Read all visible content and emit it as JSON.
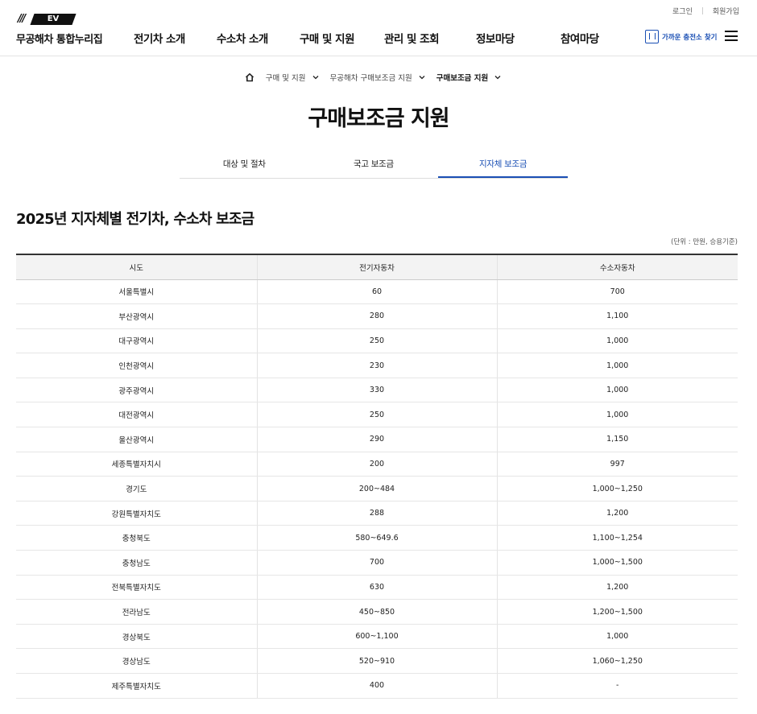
{
  "header": {
    "logo_badge": "EV",
    "logo_stripes": "///",
    "site_name": "무공해차 통합누리집",
    "util": {
      "login": "로그인",
      "signup": "회원가입"
    },
    "nav": [
      "전기차 소개",
      "수소차 소개",
      "구매 및 지원",
      "관리 및 조회",
      "정보마당",
      "참여마당"
    ],
    "charger_label": "가까운 충전소 찾기"
  },
  "breadcrumb": {
    "items": [
      "구매 및 지원",
      "무공해차 구매보조금 지원",
      "구매보조금 지원"
    ]
  },
  "page_title": "구매보조금 지원",
  "tabs": [
    {
      "label": "대상 및 절차",
      "active": false
    },
    {
      "label": "국고 보조금",
      "active": false
    },
    {
      "label": "지자체 보조금",
      "active": true
    }
  ],
  "section_title": "2025년 지자체별 전기차, 수소차 보조금",
  "unit_note": "(단위 : 만원, 승용기준)",
  "table": {
    "headers": [
      "시도",
      "전기자동차",
      "수소자동차"
    ],
    "rows": [
      [
        "서울특별시",
        "60",
        "700"
      ],
      [
        "부산광역시",
        "280",
        "1,100"
      ],
      [
        "대구광역시",
        "250",
        "1,000"
      ],
      [
        "인천광역시",
        "230",
        "1,000"
      ],
      [
        "광주광역시",
        "330",
        "1,000"
      ],
      [
        "대전광역시",
        "250",
        "1,000"
      ],
      [
        "울산광역시",
        "290",
        "1,150"
      ],
      [
        "세종특별자치시",
        "200",
        "997"
      ],
      [
        "경기도",
        "200~484",
        "1,000~1,250"
      ],
      [
        "강원특별자치도",
        "288",
        "1,200"
      ],
      [
        "충청북도",
        "580~649.6",
        "1,100~1,254"
      ],
      [
        "충청남도",
        "700",
        "1,000~1,500"
      ],
      [
        "전북특별자치도",
        "630",
        "1,200"
      ],
      [
        "전라남도",
        "450~850",
        "1,200~1,500"
      ],
      [
        "경상북도",
        "600~1,100",
        "1,000"
      ],
      [
        "경상남도",
        "520~910",
        "1,060~1,250"
      ],
      [
        "제주특별자치도",
        "400",
        "-"
      ]
    ]
  },
  "colors": {
    "accent": "#1a4fb4",
    "text": "#111111"
  }
}
